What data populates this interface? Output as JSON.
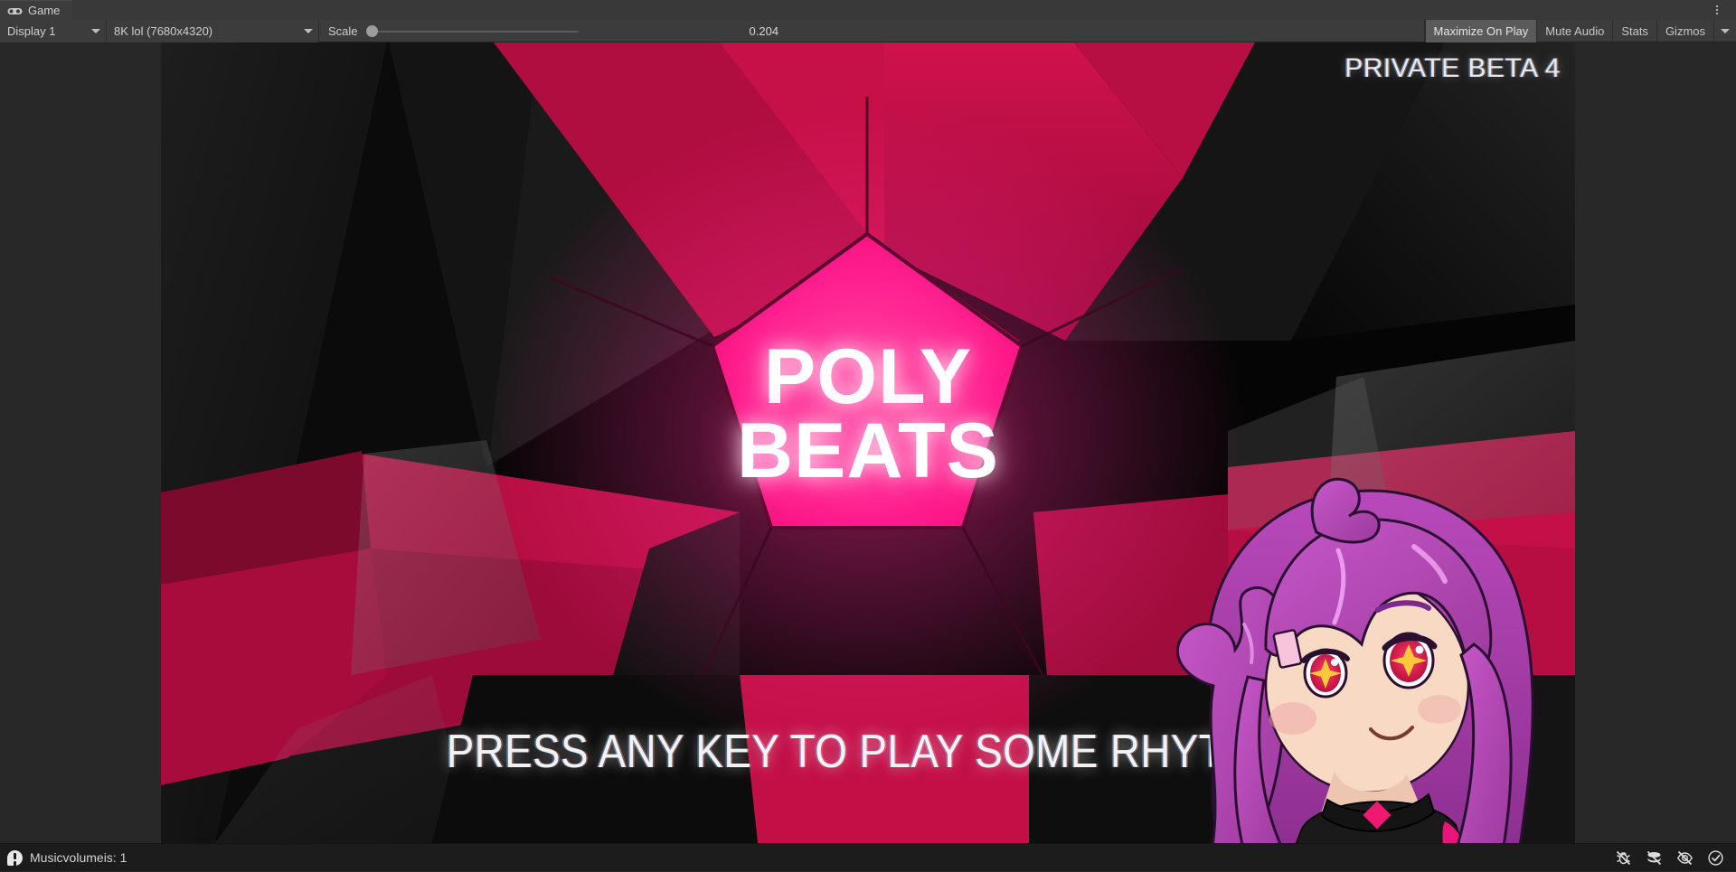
{
  "window": {
    "tab_label": "Game",
    "tab_icon": "gamepad-icon",
    "kebab_icon": "more-options-icon"
  },
  "toolbar": {
    "display_dropdown": "Display 1",
    "resolution_dropdown": "8K lol (7680x4320)",
    "scale_label": "Scale",
    "scale_value": "0.204",
    "scale_slider_position_pct": 0,
    "maximize_on_play": "Maximize On Play",
    "mute_audio": "Mute Audio",
    "stats": "Stats",
    "gizmos": "Gizmos",
    "gizmos_caret_icon": "chevron-down-icon"
  },
  "game": {
    "build_label": "PRIVATE BETA 4",
    "title_line1": "POLY",
    "title_line2": "BEATS",
    "prompt": "PRESS ANY KEY TO PLAY SOME RHYTHM",
    "accent_pink": "#ff1e8e",
    "accent_crimson": "#bd0f45",
    "background_black": "#000000",
    "character_hair": "#b949bb",
    "character_eye": "#e8184f"
  },
  "status": {
    "message": "Musicvolumeis: 1",
    "log_icon": "error-log-icon",
    "icons": [
      {
        "name": "debug-bug-off-icon"
      },
      {
        "name": "layers-collapse-icon"
      },
      {
        "name": "visibility-off-icon"
      },
      {
        "name": "check-circle-icon"
      }
    ]
  }
}
